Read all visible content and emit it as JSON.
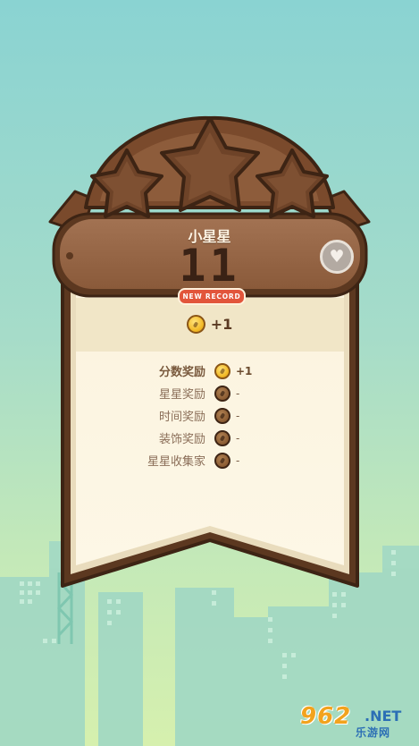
{
  "level": {
    "title": "小星星",
    "score": "11",
    "record_badge": "NEW RECORD"
  },
  "stars": {
    "total": 3,
    "earned": 0
  },
  "total_reward": {
    "icon": "coin-icon",
    "amount": "+1"
  },
  "rewards": [
    {
      "label": "分数奖励",
      "value": "+1",
      "earned": true
    },
    {
      "label": "星星奖励",
      "value": "-",
      "earned": false
    },
    {
      "label": "时间奖励",
      "value": "-",
      "earned": false
    },
    {
      "label": "装饰奖励",
      "value": "-",
      "earned": false
    },
    {
      "label": "星星收集家",
      "value": "-",
      "earned": false
    }
  ],
  "favorite_button": {
    "icon": "heart-icon"
  },
  "watermark": {
    "logo": "962",
    "domain": ".NET",
    "site": "乐游网"
  },
  "colors": {
    "wood": "#8a5a3a",
    "wood_dark": "#5c3820",
    "paper": "#fbf3de",
    "coin_gold": "#f2b824",
    "record_red": "#e2553b"
  }
}
